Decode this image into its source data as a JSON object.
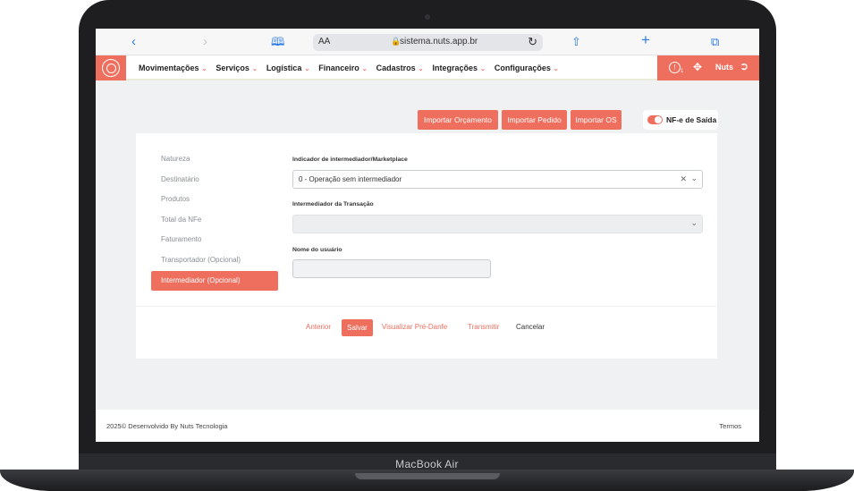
{
  "device": {
    "brand": "MacBook Air"
  },
  "browser": {
    "text_size_label": "AA",
    "url": "sistema.nuts.app.br",
    "icons": [
      "chevron-left-icon",
      "chevron-right-icon",
      "book-icon",
      "lock-icon",
      "reload-icon",
      "share-icon",
      "plus-icon",
      "tabs-icon"
    ]
  },
  "nav": {
    "menu": [
      {
        "label": "Movimentações"
      },
      {
        "label": "Serviços"
      },
      {
        "label": "Logística"
      },
      {
        "label": "Financeiro"
      },
      {
        "label": "Cadastros"
      },
      {
        "label": "Integrações"
      },
      {
        "label": "Configurações"
      }
    ],
    "notification_count": "1",
    "user_name": "Nuts",
    "accent": "#ef6f5e"
  },
  "toolbar": {
    "import_budget": "Importar Orçamento",
    "import_order": "Importar Pedido",
    "import_os": "Importar OS",
    "toggle_label": "NF-e de Saída",
    "toggle_on": true
  },
  "steps": [
    {
      "label": "Natureza",
      "active": false
    },
    {
      "label": "Destinatário",
      "active": false
    },
    {
      "label": "Produtos",
      "active": false
    },
    {
      "label": "Total da NFe",
      "active": false
    },
    {
      "label": "Faturamento",
      "active": false
    },
    {
      "label": "Transportador (Opcional)",
      "active": false
    },
    {
      "label": "Intermediador (Opcional)",
      "active": true
    }
  ],
  "form": {
    "indicator_label": "Indicador de intermediador/Marketplace",
    "indicator_value": "0 - Operação sem intermediador",
    "transaction_label": "Intermediador da Transação",
    "transaction_value": "",
    "username_label": "Nome do usuário",
    "username_value": ""
  },
  "actions": {
    "previous": "Anterior",
    "save": "Salvar",
    "preview": "Visualizar Pré-Danfe",
    "transmit": "Transmitir",
    "cancel": "Cancelar"
  },
  "footer": {
    "copyright": "2025© Desenvolvido By Nuts Tecnologia",
    "terms": "Termos"
  }
}
